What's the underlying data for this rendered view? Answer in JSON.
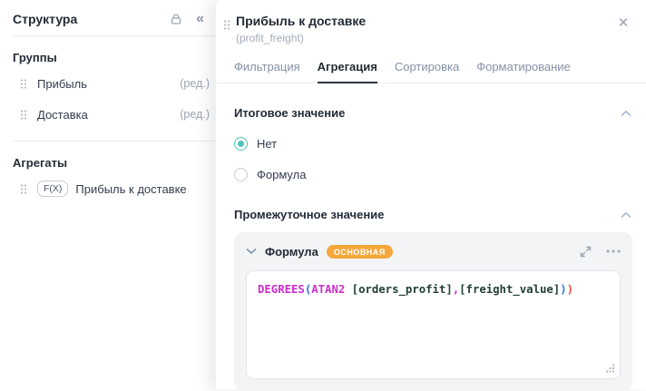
{
  "left_panel": {
    "title": "Структура",
    "collapse_glyph": "«",
    "groups_heading": "Группы",
    "group_items": [
      {
        "label": "Прибыль",
        "edit": "(ред.)"
      },
      {
        "label": "Доставка",
        "edit": "(ред.)"
      }
    ],
    "aggregates_heading": "Агрегаты",
    "aggregate_item": {
      "badge": "F(X)",
      "label": "Прибыль к доставке"
    }
  },
  "panel": {
    "title": "Прибыль к доставке",
    "subtitle": "(profit_freight)",
    "close_glyph": "✕",
    "tabs": [
      {
        "label": "Фильтрация"
      },
      {
        "label": "Агрегация"
      },
      {
        "label": "Сортировка"
      },
      {
        "label": "Форматирование"
      }
    ],
    "active_tab": "Агрегация",
    "total_section": {
      "heading": "Итоговое значение",
      "options": [
        {
          "label": "Нет",
          "selected": true
        },
        {
          "label": "Формула",
          "selected": false
        }
      ]
    },
    "intermediate_section": {
      "heading": "Промежуточное значение",
      "card": {
        "title": "Формула",
        "badge": "ОСНОВНАЯ",
        "formula_text": "DEGREES(ATAN2 [orders_profit],[freight_value]))",
        "formula_tokens": [
          {
            "text": "DEGREES",
            "type": "fn"
          },
          {
            "text": "(",
            "type": "paren"
          },
          {
            "text": "ATAN2",
            "type": "fn"
          },
          {
            "text": " [orders_profit]",
            "type": "field"
          },
          {
            "text": ",",
            "type": "comma"
          },
          {
            "text": "[freight_value]",
            "type": "field"
          },
          {
            "text": ")",
            "type": "paren"
          },
          {
            "text": ")",
            "type": "error"
          }
        ]
      }
    }
  },
  "colors": {
    "accent_teal": "#4fc4bc",
    "badge_orange": "#f5a73b",
    "function_magenta": "#cc2ecc",
    "paren_blue": "#2f77e0",
    "error_red": "#ef4b3e",
    "field_dark": "#223f3a",
    "active_tab_dark": "#2d3540"
  },
  "icons": {
    "lock": "lock-icon",
    "collapse": "collapse-panel-icon",
    "drag": "drag-handle-icon",
    "close": "close-icon",
    "chevron_up": "chevron-up-icon",
    "chevron_down": "chevron-down-icon",
    "expand": "expand-icon",
    "more": "more-options-icon",
    "resize": "resize-handle-icon"
  }
}
